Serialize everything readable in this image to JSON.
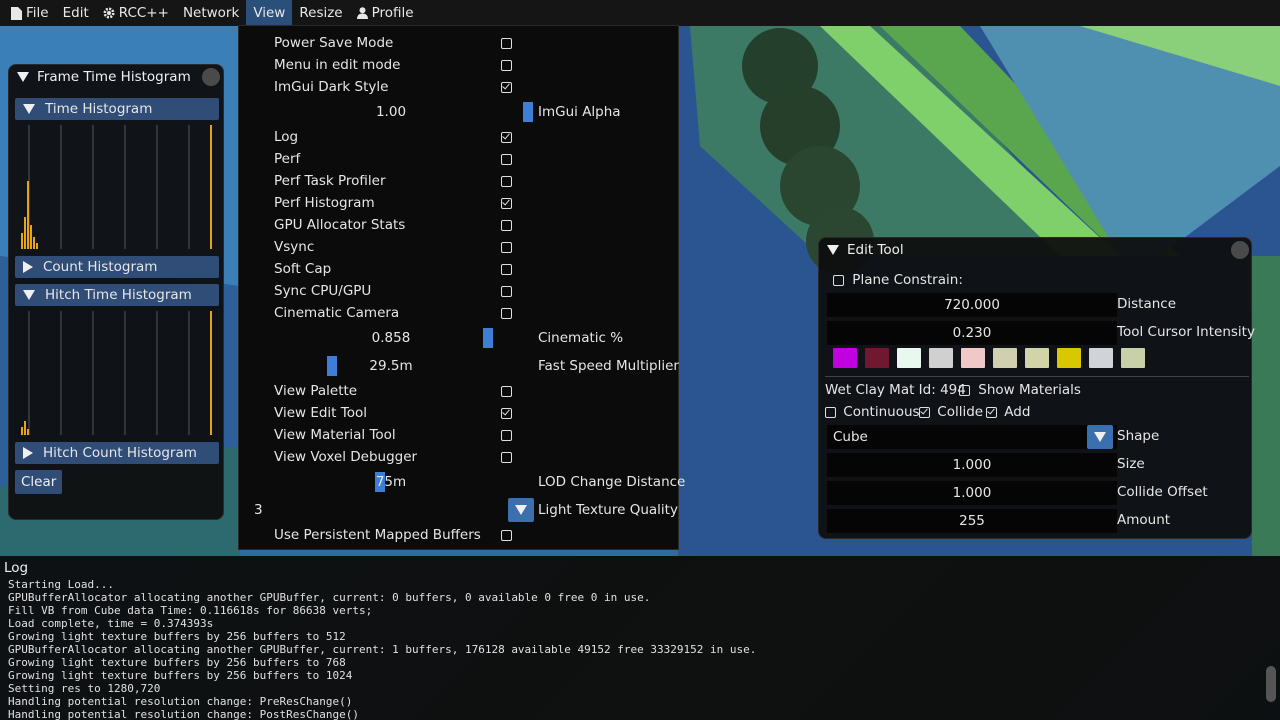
{
  "menubar": {
    "items": [
      {
        "label": "File",
        "icon": "file-icon"
      },
      {
        "label": "Edit",
        "icon": ""
      },
      {
        "label": "RCC++",
        "icon": "gear-icon"
      },
      {
        "label": "Network",
        "icon": ""
      },
      {
        "label": "View",
        "icon": ""
      },
      {
        "label": "Resize",
        "icon": ""
      },
      {
        "label": "Profile",
        "icon": "user-icon"
      }
    ],
    "active": "View"
  },
  "histogram_window": {
    "title": "Frame Time Histogram",
    "sections": [
      {
        "label": "Time Histogram",
        "open": true
      },
      {
        "label": "Count Histogram",
        "open": false
      },
      {
        "label": "Hitch Time Histogram",
        "open": true
      },
      {
        "label": "Hitch Count Histogram",
        "open": false
      }
    ],
    "clear_label": "Clear",
    "accent_color": "#e8a317"
  },
  "view_menu": {
    "items": [
      {
        "type": "check",
        "label": "Power Save Mode",
        "checked": false
      },
      {
        "type": "check",
        "label": "Menu in edit mode",
        "checked": false
      },
      {
        "type": "check",
        "label": "ImGui Dark Style",
        "checked": true
      },
      {
        "type": "slider",
        "value": "1.00",
        "label": "ImGui Alpha",
        "fraction": 1.0
      },
      {
        "type": "check",
        "label": "Log",
        "checked": true
      },
      {
        "type": "check",
        "label": "Perf",
        "checked": false
      },
      {
        "type": "check",
        "label": "Perf Task Profiler",
        "checked": false
      },
      {
        "type": "check",
        "label": "Perf Histogram",
        "checked": true
      },
      {
        "type": "check",
        "label": "GPU Allocator Stats",
        "checked": false
      },
      {
        "type": "check",
        "label": "Vsync",
        "checked": false
      },
      {
        "type": "check",
        "label": "Soft Cap",
        "checked": false
      },
      {
        "type": "check",
        "label": "Sync CPU/GPU",
        "checked": false
      },
      {
        "type": "check",
        "label": "Cinematic Camera",
        "checked": false
      },
      {
        "type": "slider",
        "value": "0.858",
        "label": "Cinematic %",
        "fraction": 0.86
      },
      {
        "type": "slider",
        "value": "29.5m",
        "label": "Fast Speed Multiplier",
        "fraction": 0.0
      },
      {
        "type": "check",
        "label": "View Palette",
        "checked": false
      },
      {
        "type": "check",
        "label": "View Edit Tool",
        "checked": true
      },
      {
        "type": "check",
        "label": "View Material Tool",
        "checked": false
      },
      {
        "type": "check",
        "label": "View Voxel Debugger",
        "checked": false
      },
      {
        "type": "slider",
        "value": "75m",
        "label": "LOD Change Distance",
        "fraction": 0.16
      },
      {
        "type": "combo",
        "value": "3",
        "label": "Light Texture Quality"
      },
      {
        "type": "check",
        "label": "Use Persistent Mapped Buffers",
        "checked": false
      }
    ]
  },
  "edit_tool": {
    "title": "Edit Tool",
    "plane_constrain": {
      "label": "Plane Constrain:",
      "checked": false
    },
    "distance": {
      "value": "720.000",
      "label": "Distance"
    },
    "cursor_intensity": {
      "value": "0.230",
      "label": "Tool Cursor Intensity"
    },
    "swatches": [
      "#c000e0",
      "#701830",
      "#e8f8ee",
      "#d0d0d0",
      "#f0c8c8",
      "#d0d0b0",
      "#d0d4a8",
      "#d8c800",
      "#d0d4d8",
      "#c8d0a8"
    ],
    "mat_label": "Wet Clay Mat Id: 494",
    "show_materials": {
      "label": "Show Materials",
      "checked": false
    },
    "continuous": {
      "label": "Continuous",
      "checked": false
    },
    "collide": {
      "label": "Collide",
      "checked": true
    },
    "add": {
      "label": "Add",
      "checked": true
    },
    "shape": {
      "value": "Cube",
      "label": "Shape"
    },
    "size": {
      "value": "1.000",
      "label": "Size"
    },
    "collide_offset": {
      "value": "1.000",
      "label": "Collide Offset"
    },
    "amount": {
      "value": "255",
      "label": "Amount"
    }
  },
  "log": {
    "title": "Log",
    "lines": [
      "Starting Load...",
      "GPUBufferAllocator allocating another GPUBuffer, current: 0 buffers, 0 available 0 free 0 in use.",
      "Fill VB from Cube data Time: 0.116618s for 86638 verts;",
      "Load complete, time = 0.374393s",
      "Growing light texture buffers by 256 buffers to 512",
      "GPUBufferAllocator allocating another GPUBuffer, current: 1 buffers, 176128 available 49152 free 33329152 in use.",
      "Growing light texture buffers by 256 buffers to 768",
      "Growing light texture buffers by 256 buffers to 1024",
      "Setting res to 1280,720",
      "Handling potential resolution change: PreResChange()",
      "Handling potential resolution change: PostResChange()"
    ]
  }
}
